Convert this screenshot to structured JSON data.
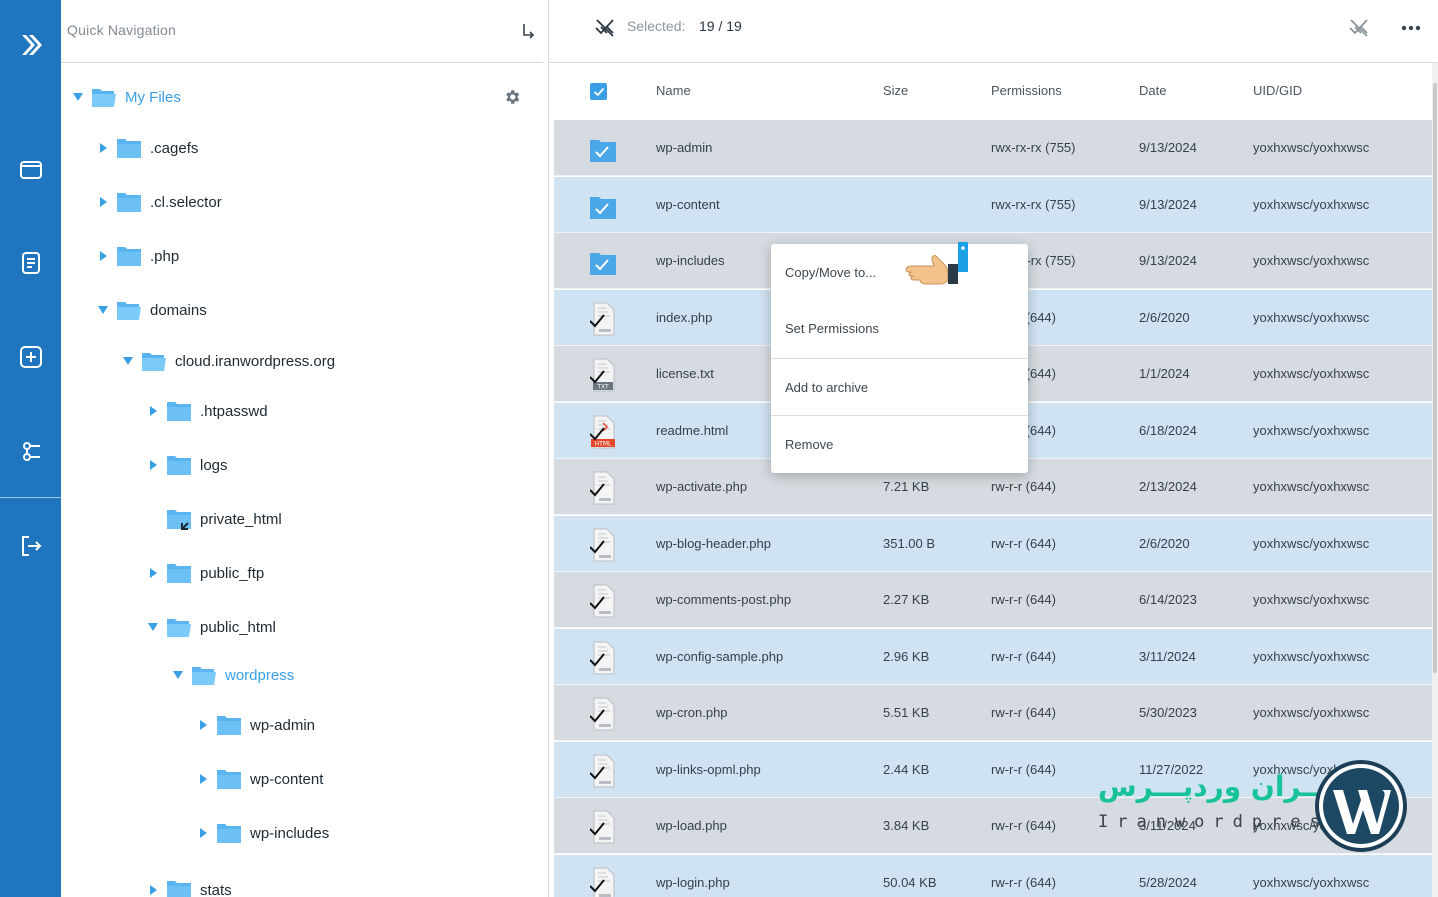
{
  "sidebar_rail": {
    "items": [
      {
        "name": "logo",
        "icon": "chevron-logo-icon"
      },
      {
        "name": "files",
        "icon": "folder-icon"
      },
      {
        "name": "editor",
        "icon": "document-icon"
      },
      {
        "name": "new",
        "icon": "plus-icon"
      },
      {
        "name": "connections",
        "icon": "nodes-icon"
      },
      {
        "name": "logout",
        "icon": "logout-icon"
      }
    ],
    "color": "#1f76bf"
  },
  "tree": {
    "title": "Quick Navigation",
    "jump_icon": "enter-arrow-icon",
    "settings_icon": "gear-icon",
    "nodes": [
      {
        "label": "My Files",
        "expanded": true,
        "active": true
      },
      {
        "label": ".cagefs",
        "expanded": false
      },
      {
        "label": ".cl.selector",
        "expanded": false
      },
      {
        "label": ".php",
        "expanded": false
      },
      {
        "label": "domains",
        "expanded": true
      },
      {
        "label": "cloud.iranwordpress.org",
        "expanded": true
      },
      {
        "label": ".htpasswd",
        "expanded": false
      },
      {
        "label": "logs",
        "expanded": false
      },
      {
        "label": "private_html",
        "expanded": false,
        "symlink": true
      },
      {
        "label": "public_ftp",
        "expanded": false
      },
      {
        "label": "public_html",
        "expanded": true
      },
      {
        "label": "wordpress",
        "expanded": true,
        "active": true
      },
      {
        "label": "wp-admin",
        "expanded": false
      },
      {
        "label": "wp-content",
        "expanded": false
      },
      {
        "label": "wp-includes",
        "expanded": false
      },
      {
        "label": "stats",
        "expanded": false
      }
    ]
  },
  "toolbar": {
    "selected_label": "Selected:",
    "selected_count": "19 / 19",
    "more_icon": "ellipsis-icon"
  },
  "table": {
    "columns": [
      "Name",
      "Size",
      "Permissions",
      "Date",
      "UID/GID"
    ],
    "rows": [
      {
        "name": "wp-admin",
        "type": "folder",
        "size": "",
        "perm": "rwx-rx-rx (755)",
        "date": "9/13/2024",
        "uid": "yoxhxwsc/yoxhxwsc"
      },
      {
        "name": "wp-content",
        "type": "folder",
        "size": "",
        "perm": "rwx-rx-rx (755)",
        "date": "9/13/2024",
        "uid": "yoxhxwsc/yoxhxwsc"
      },
      {
        "name": "wp-includes",
        "type": "folder",
        "size": "",
        "perm": "rwx-rx-rx (755)",
        "date": "9/13/2024",
        "uid": "yoxhxwsc/yoxhxwsc"
      },
      {
        "name": "index.php",
        "type": "php",
        "size": "",
        "perm": "rw-r-r (644)",
        "date": "2/6/2020",
        "uid": "yoxhxwsc/yoxhxwsc"
      },
      {
        "name": "license.txt",
        "type": "txt",
        "size": "",
        "perm": "rw-r-r (644)",
        "date": "1/1/2024",
        "uid": "yoxhxwsc/yoxhxwsc"
      },
      {
        "name": "readme.html",
        "type": "html",
        "size": "",
        "perm": "rw-r-r (644)",
        "date": "6/18/2024",
        "uid": "yoxhxwsc/yoxhxwsc"
      },
      {
        "name": "wp-activate.php",
        "type": "php",
        "size": "7.21 KB",
        "perm": "rw-r-r (644)",
        "date": "2/13/2024",
        "uid": "yoxhxwsc/yoxhxwsc"
      },
      {
        "name": "wp-blog-header.php",
        "type": "php",
        "size": "351.00 B",
        "perm": "rw-r-r (644)",
        "date": "2/6/2020",
        "uid": "yoxhxwsc/yoxhxwsc"
      },
      {
        "name": "wp-comments-post.php",
        "type": "php",
        "size": "2.27 KB",
        "perm": "rw-r-r (644)",
        "date": "6/14/2023",
        "uid": "yoxhxwsc/yoxhxwsc"
      },
      {
        "name": "wp-config-sample.php",
        "type": "php",
        "size": "2.96 KB",
        "perm": "rw-r-r (644)",
        "date": "3/11/2024",
        "uid": "yoxhxwsc/yoxhxwsc"
      },
      {
        "name": "wp-cron.php",
        "type": "php",
        "size": "5.51 KB",
        "perm": "rw-r-r (644)",
        "date": "5/30/2023",
        "uid": "yoxhxwsc/yoxhxwsc"
      },
      {
        "name": "wp-links-opml.php",
        "type": "php",
        "size": "2.44 KB",
        "perm": "rw-r-r (644)",
        "date": "11/27/2022",
        "uid": "yoxhxwsc/yoxhxwsc"
      },
      {
        "name": "wp-load.php",
        "type": "php",
        "size": "3.84 KB",
        "perm": "rw-r-r (644)",
        "date": "3/11/2024",
        "uid": "yoxhxwsc/yoxhxwsc"
      },
      {
        "name": "wp-login.php",
        "type": "php",
        "size": "50.04 KB",
        "perm": "rw-r-r (644)",
        "date": "5/28/2024",
        "uid": "yoxhxwsc/yoxhxwsc"
      }
    ]
  },
  "context_menu": {
    "items": [
      "Copy/Move to...",
      "Set Permissions",
      "Add to archive",
      "Remove"
    ]
  },
  "watermark": {
    "fa": "ایــران وردپـــرس",
    "en": "Iranwordpress"
  }
}
